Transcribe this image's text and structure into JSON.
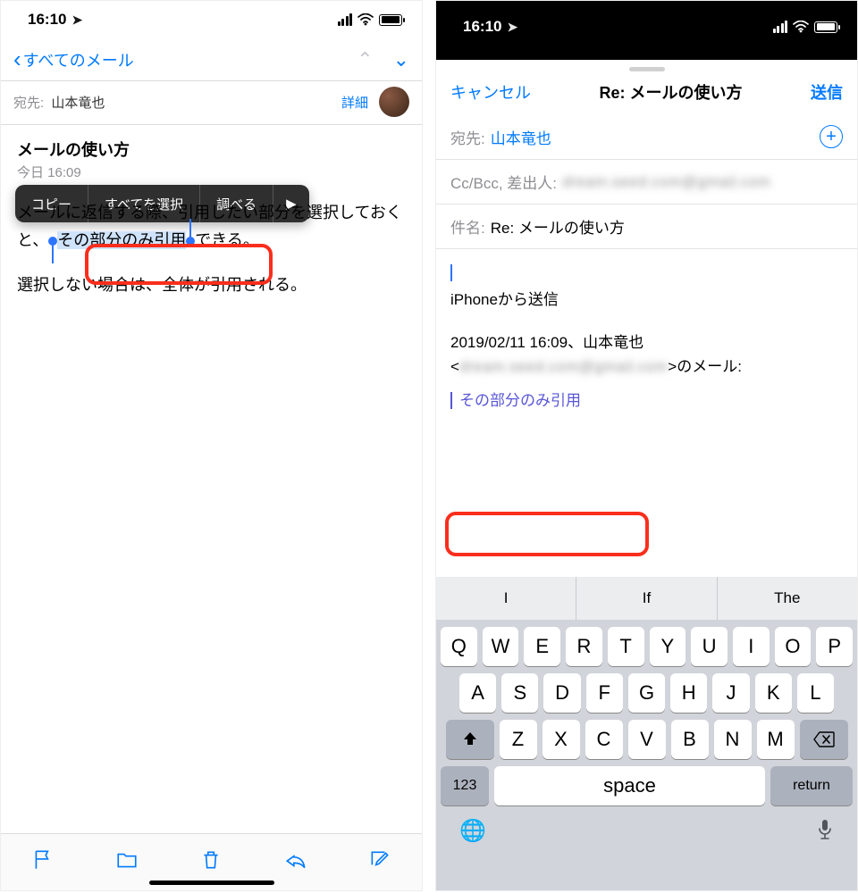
{
  "status": {
    "time": "16:10"
  },
  "left": {
    "back_label": "すべてのメール",
    "to_label": "宛先:",
    "to_name": "山本竜也",
    "detail": "詳細",
    "title": "メールの使い方",
    "date": "今日 16:09",
    "popup": {
      "copy": "コピー",
      "select_all": "すべてを選択",
      "lookup": "調べる",
      "more": "▶"
    },
    "body_pre": "メールに返信する際、引用したい部分を選択しておくと、",
    "body_sel": "その部分のみ引用",
    "body_post": "できる。",
    "body_p2": "選択しない場合は、全体が引用される。"
  },
  "right": {
    "cancel": "キャンセル",
    "title": "Re: メールの使い方",
    "send": "送信",
    "to_label": "宛先:",
    "to_name": "山本竜也",
    "cc_label": "Cc/Bcc, 差出人:",
    "cc_blur": "dream.seed.com@gmail.com",
    "subj_label": "件名:",
    "subj_value": "Re: メールの使い方",
    "sig": "iPhoneから送信",
    "date_line": "2019/02/11 16:09、山本竜也",
    "email_blur": "dream.seed.com@gmail.com",
    "date_suffix": ">のメール:",
    "quote": "その部分のみ引用"
  },
  "keyboard": {
    "suggestions": [
      "I",
      "If",
      "The"
    ],
    "row1": [
      "Q",
      "W",
      "E",
      "R",
      "T",
      "Y",
      "U",
      "I",
      "O",
      "P"
    ],
    "row2": [
      "A",
      "S",
      "D",
      "F",
      "G",
      "H",
      "J",
      "K",
      "L"
    ],
    "row3": [
      "Z",
      "X",
      "C",
      "V",
      "B",
      "N",
      "M"
    ],
    "num": "123",
    "space": "space",
    "return": "return"
  }
}
